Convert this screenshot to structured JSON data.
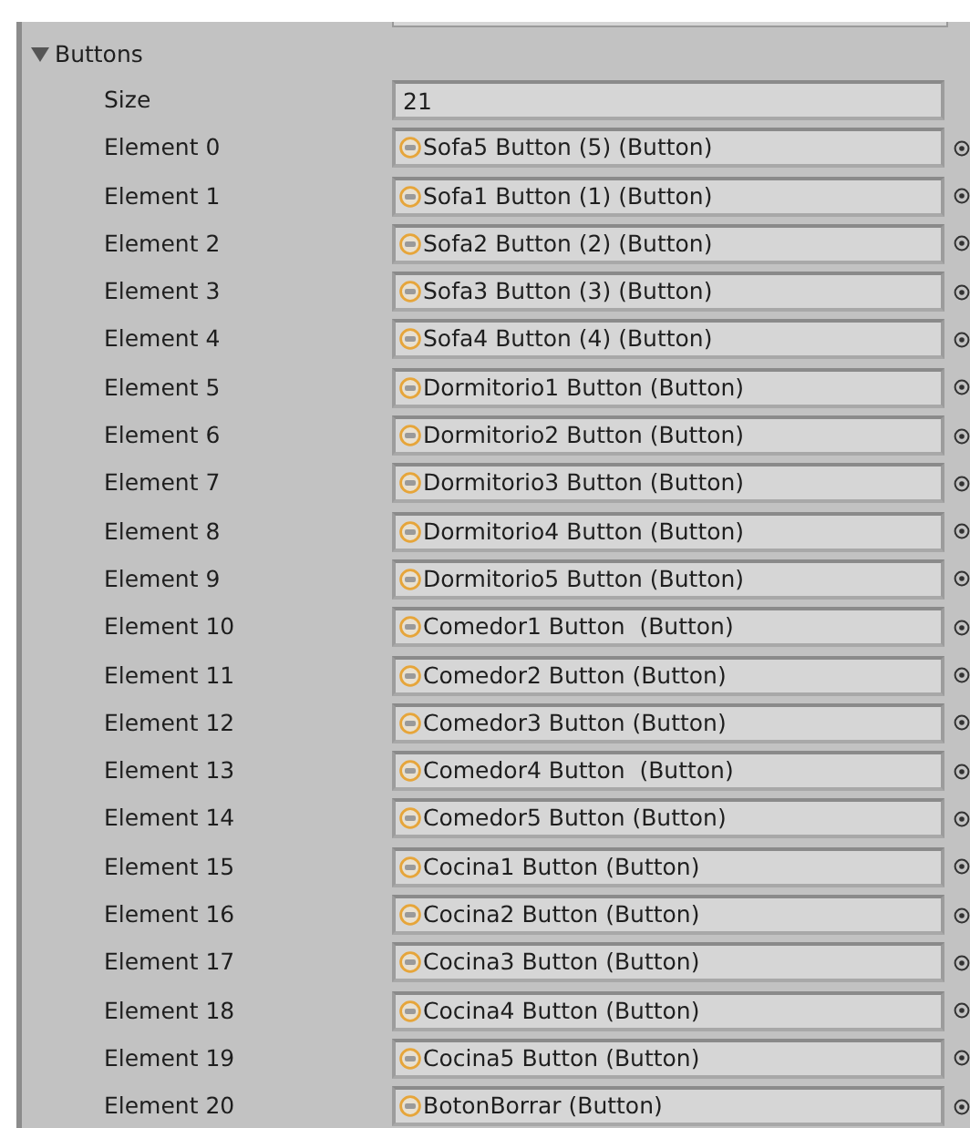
{
  "section": {
    "title": "Buttons",
    "expanded": true
  },
  "size": {
    "label": "Size",
    "value": "21"
  },
  "elements": [
    {
      "label": "Element 0",
      "value": "Sofa5 Button (5) (Button)"
    },
    {
      "label": "Element 1",
      "value": "Sofa1 Button (1) (Button)"
    },
    {
      "label": "Element 2",
      "value": "Sofa2 Button (2) (Button)"
    },
    {
      "label": "Element 3",
      "value": "Sofa3 Button (3) (Button)"
    },
    {
      "label": "Element 4",
      "value": "Sofa4 Button (4) (Button)"
    },
    {
      "label": "Element 5",
      "value": "Dormitorio1 Button (Button)"
    },
    {
      "label": "Element 6",
      "value": "Dormitorio2 Button (Button)"
    },
    {
      "label": "Element 7",
      "value": "Dormitorio3 Button (Button)"
    },
    {
      "label": "Element 8",
      "value": "Dormitorio4 Button (Button)"
    },
    {
      "label": "Element 9",
      "value": "Dormitorio5 Button (Button)"
    },
    {
      "label": "Element 10",
      "value": "Comedor1 Button  (Button)"
    },
    {
      "label": "Element 11",
      "value": "Comedor2 Button (Button)"
    },
    {
      "label": "Element 12",
      "value": "Comedor3 Button (Button)"
    },
    {
      "label": "Element 13",
      "value": "Comedor4 Button  (Button)"
    },
    {
      "label": "Element 14",
      "value": "Comedor5 Button (Button)"
    },
    {
      "label": "Element 15",
      "value": "Cocina1 Button (Button)"
    },
    {
      "label": "Element 16",
      "value": "Cocina2 Button (Button)"
    },
    {
      "label": "Element 17",
      "value": "Cocina3 Button (Button)"
    },
    {
      "label": "Element 18",
      "value": "Cocina4 Button (Button)"
    },
    {
      "label": "Element 19",
      "value": "Cocina5 Button (Button)"
    },
    {
      "label": "Element 20",
      "value": "BotonBorrar (Button)"
    }
  ]
}
